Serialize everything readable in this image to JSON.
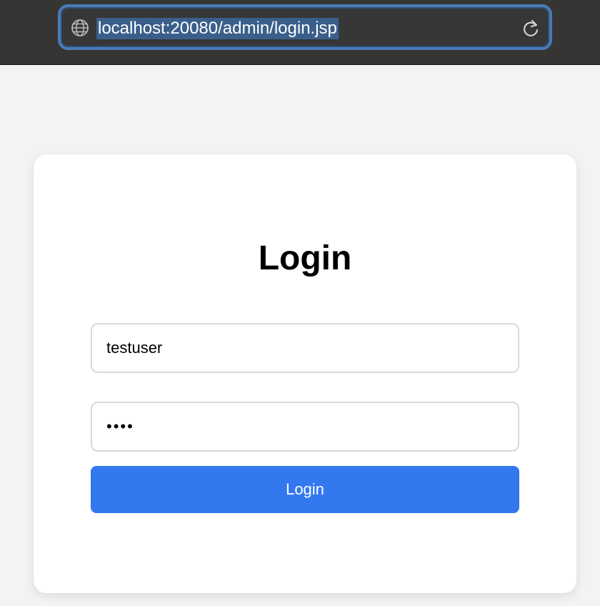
{
  "browser": {
    "url": "localhost:20080/admin/login.jsp",
    "globe_icon": "globe-icon",
    "reload_icon": "reload-icon"
  },
  "login": {
    "title": "Login",
    "username_value": "testuser",
    "password_value": "test",
    "button_label": "Login"
  },
  "colors": {
    "accent": "#3478f0",
    "browser_bar": "#353533",
    "url_highlight": "#3a5f8b"
  }
}
